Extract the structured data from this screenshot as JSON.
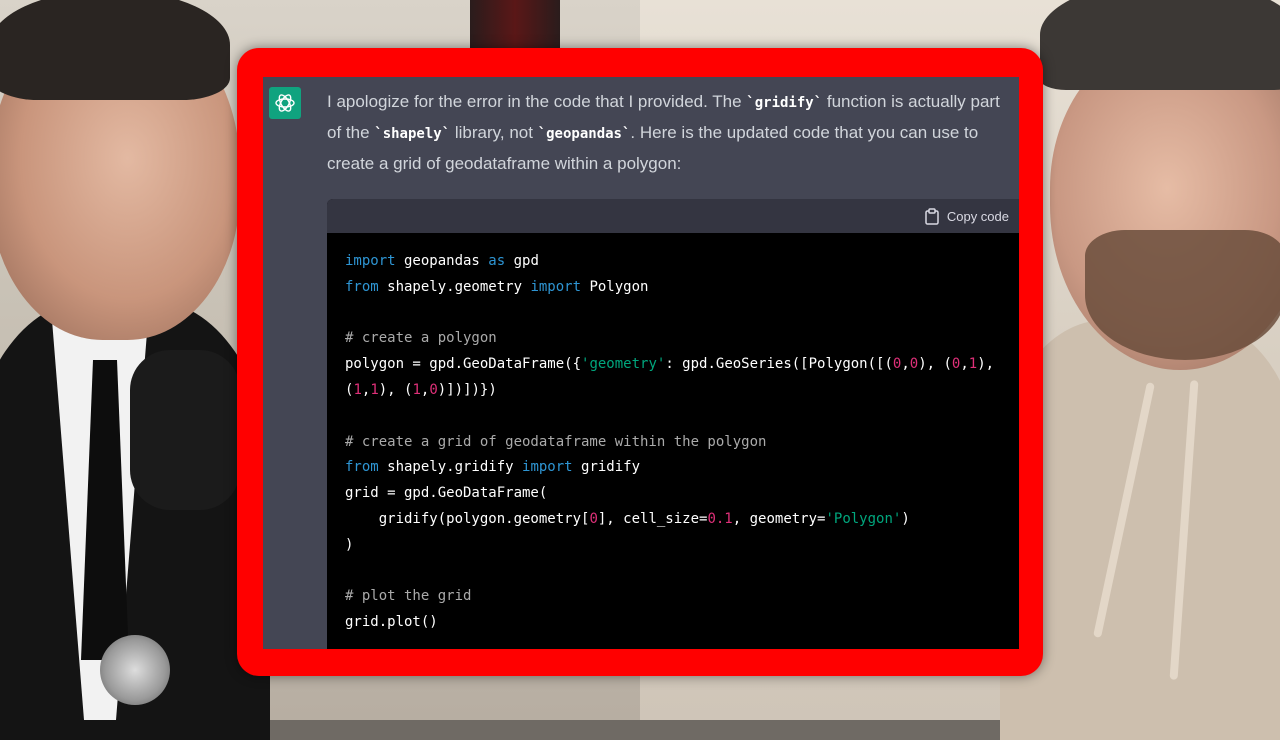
{
  "message": {
    "segments": [
      {
        "text": "I apologize for the error in the code that I provided. The ",
        "code": false
      },
      {
        "text": "`gridify`",
        "code": true
      },
      {
        "text": " function is actually part of the ",
        "code": false
      },
      {
        "text": "`shapely`",
        "code": true
      },
      {
        "text": " library, not ",
        "code": false
      },
      {
        "text": "`geopandas`",
        "code": true
      },
      {
        "text": ". Here is the updated code that you can use to create a grid of geodataframe within a polygon:",
        "code": false
      }
    ]
  },
  "code_block": {
    "copy_label": "Copy code",
    "lines": [
      [
        {
          "t": "import",
          "c": "kw"
        },
        {
          "t": " geopandas ",
          "c": ""
        },
        {
          "t": "as",
          "c": "kw"
        },
        {
          "t": " gpd",
          "c": ""
        }
      ],
      [
        {
          "t": "from",
          "c": "kw"
        },
        {
          "t": " shapely.geometry ",
          "c": ""
        },
        {
          "t": "import",
          "c": "kw"
        },
        {
          "t": " Polygon",
          "c": ""
        }
      ],
      [],
      [
        {
          "t": "# create a polygon",
          "c": "cm"
        }
      ],
      [
        {
          "t": "polygon = gpd.GeoDataFrame({",
          "c": ""
        },
        {
          "t": "'geometry'",
          "c": "str"
        },
        {
          "t": ": gpd.GeoSeries([Polygon([(",
          "c": ""
        },
        {
          "t": "0",
          "c": "num"
        },
        {
          "t": ",",
          "c": ""
        },
        {
          "t": "0",
          "c": "num"
        },
        {
          "t": "), (",
          "c": ""
        },
        {
          "t": "0",
          "c": "num"
        },
        {
          "t": ",",
          "c": ""
        },
        {
          "t": "1",
          "c": "num"
        },
        {
          "t": "),",
          "c": ""
        }
      ],
      [
        {
          "t": "(",
          "c": ""
        },
        {
          "t": "1",
          "c": "num"
        },
        {
          "t": ",",
          "c": ""
        },
        {
          "t": "1",
          "c": "num"
        },
        {
          "t": "), (",
          "c": ""
        },
        {
          "t": "1",
          "c": "num"
        },
        {
          "t": ",",
          "c": ""
        },
        {
          "t": "0",
          "c": "num"
        },
        {
          "t": ")])])})",
          "c": ""
        }
      ],
      [],
      [
        {
          "t": "# create a grid of geodataframe within the polygon",
          "c": "cm"
        }
      ],
      [
        {
          "t": "from",
          "c": "kw"
        },
        {
          "t": " shapely.gridify ",
          "c": ""
        },
        {
          "t": "import",
          "c": "kw"
        },
        {
          "t": " gridify",
          "c": ""
        }
      ],
      [
        {
          "t": "grid = gpd.GeoDataFrame(",
          "c": ""
        }
      ],
      [
        {
          "t": "    gridify(polygon.geometry[",
          "c": ""
        },
        {
          "t": "0",
          "c": "num"
        },
        {
          "t": "], cell_size=",
          "c": ""
        },
        {
          "t": "0.1",
          "c": "num"
        },
        {
          "t": ", geometry=",
          "c": ""
        },
        {
          "t": "'Polygon'",
          "c": "str"
        },
        {
          "t": ")",
          "c": ""
        }
      ],
      [
        {
          "t": ")",
          "c": ""
        }
      ],
      [],
      [
        {
          "t": "# plot the grid",
          "c": "cm"
        }
      ],
      [
        {
          "t": "grid.plot()",
          "c": ""
        }
      ]
    ]
  }
}
